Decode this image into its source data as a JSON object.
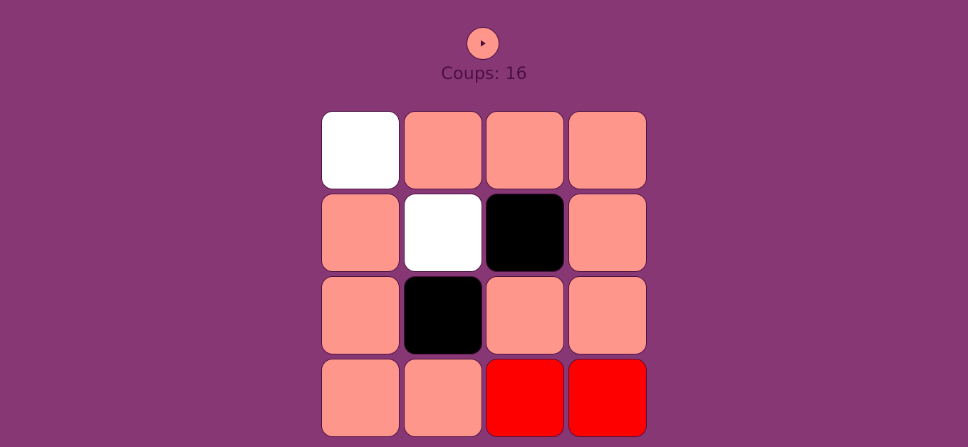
{
  "header": {
    "play_button": {
      "icon": "play-icon"
    },
    "moves_text": "Coups: 16"
  },
  "colors": {
    "background": "#883775",
    "border": "#4a1040",
    "salmon": "#ff968c",
    "white": "#ffffff",
    "black": "#000000",
    "red": "#ff0000"
  },
  "board": {
    "rows": 4,
    "cols": 4,
    "tiles": [
      [
        "white",
        "salmon",
        "salmon",
        "salmon"
      ],
      [
        "salmon",
        "white",
        "black",
        "salmon"
      ],
      [
        "salmon",
        "black",
        "salmon",
        "salmon"
      ],
      [
        "salmon",
        "salmon",
        "red",
        "red"
      ]
    ]
  }
}
